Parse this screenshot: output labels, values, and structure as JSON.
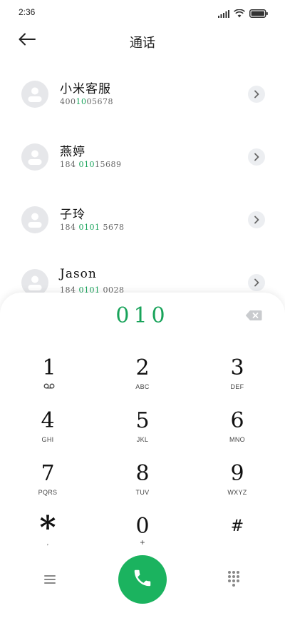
{
  "status_bar": {
    "time": "2:36"
  },
  "header": {
    "title": "通话"
  },
  "contacts": [
    {
      "name": "小米客服",
      "number_pre": "400",
      "number_match": "10",
      "number_post": "05678"
    },
    {
      "name": "燕婷",
      "number_pre": "184 ",
      "number_match": "010",
      "number_post": "15689"
    },
    {
      "name": "子玲",
      "number_pre": "184 ",
      "number_match": "0101",
      "number_post": " 5678"
    },
    {
      "name": "Jason",
      "number_pre": "184 ",
      "number_match": "0101",
      "number_post": " 0028"
    }
  ],
  "dialer": {
    "input": "010",
    "keys": [
      {
        "digit": "1",
        "letters": ""
      },
      {
        "digit": "2",
        "letters": "ABC"
      },
      {
        "digit": "3",
        "letters": "DEF"
      },
      {
        "digit": "4",
        "letters": "GHI"
      },
      {
        "digit": "5",
        "letters": "JKL"
      },
      {
        "digit": "6",
        "letters": "MNO"
      },
      {
        "digit": "7",
        "letters": "PQRS"
      },
      {
        "digit": "8",
        "letters": "TUV"
      },
      {
        "digit": "9",
        "letters": "WXYZ"
      },
      {
        "digit": "*",
        "letters": ","
      },
      {
        "digit": "0",
        "letters": "+"
      },
      {
        "digit": "#",
        "letters": ""
      }
    ]
  },
  "colors": {
    "accent": "#18a35a",
    "call_button": "#1bb35f"
  },
  "icons": [
    "signal-icon",
    "wifi-icon",
    "battery-icon",
    "back-arrow-icon",
    "contact-avatar-icon",
    "chevron-right-icon",
    "backspace-icon",
    "voicemail-icon",
    "menu-icon",
    "phone-icon",
    "keypad-icon"
  ]
}
